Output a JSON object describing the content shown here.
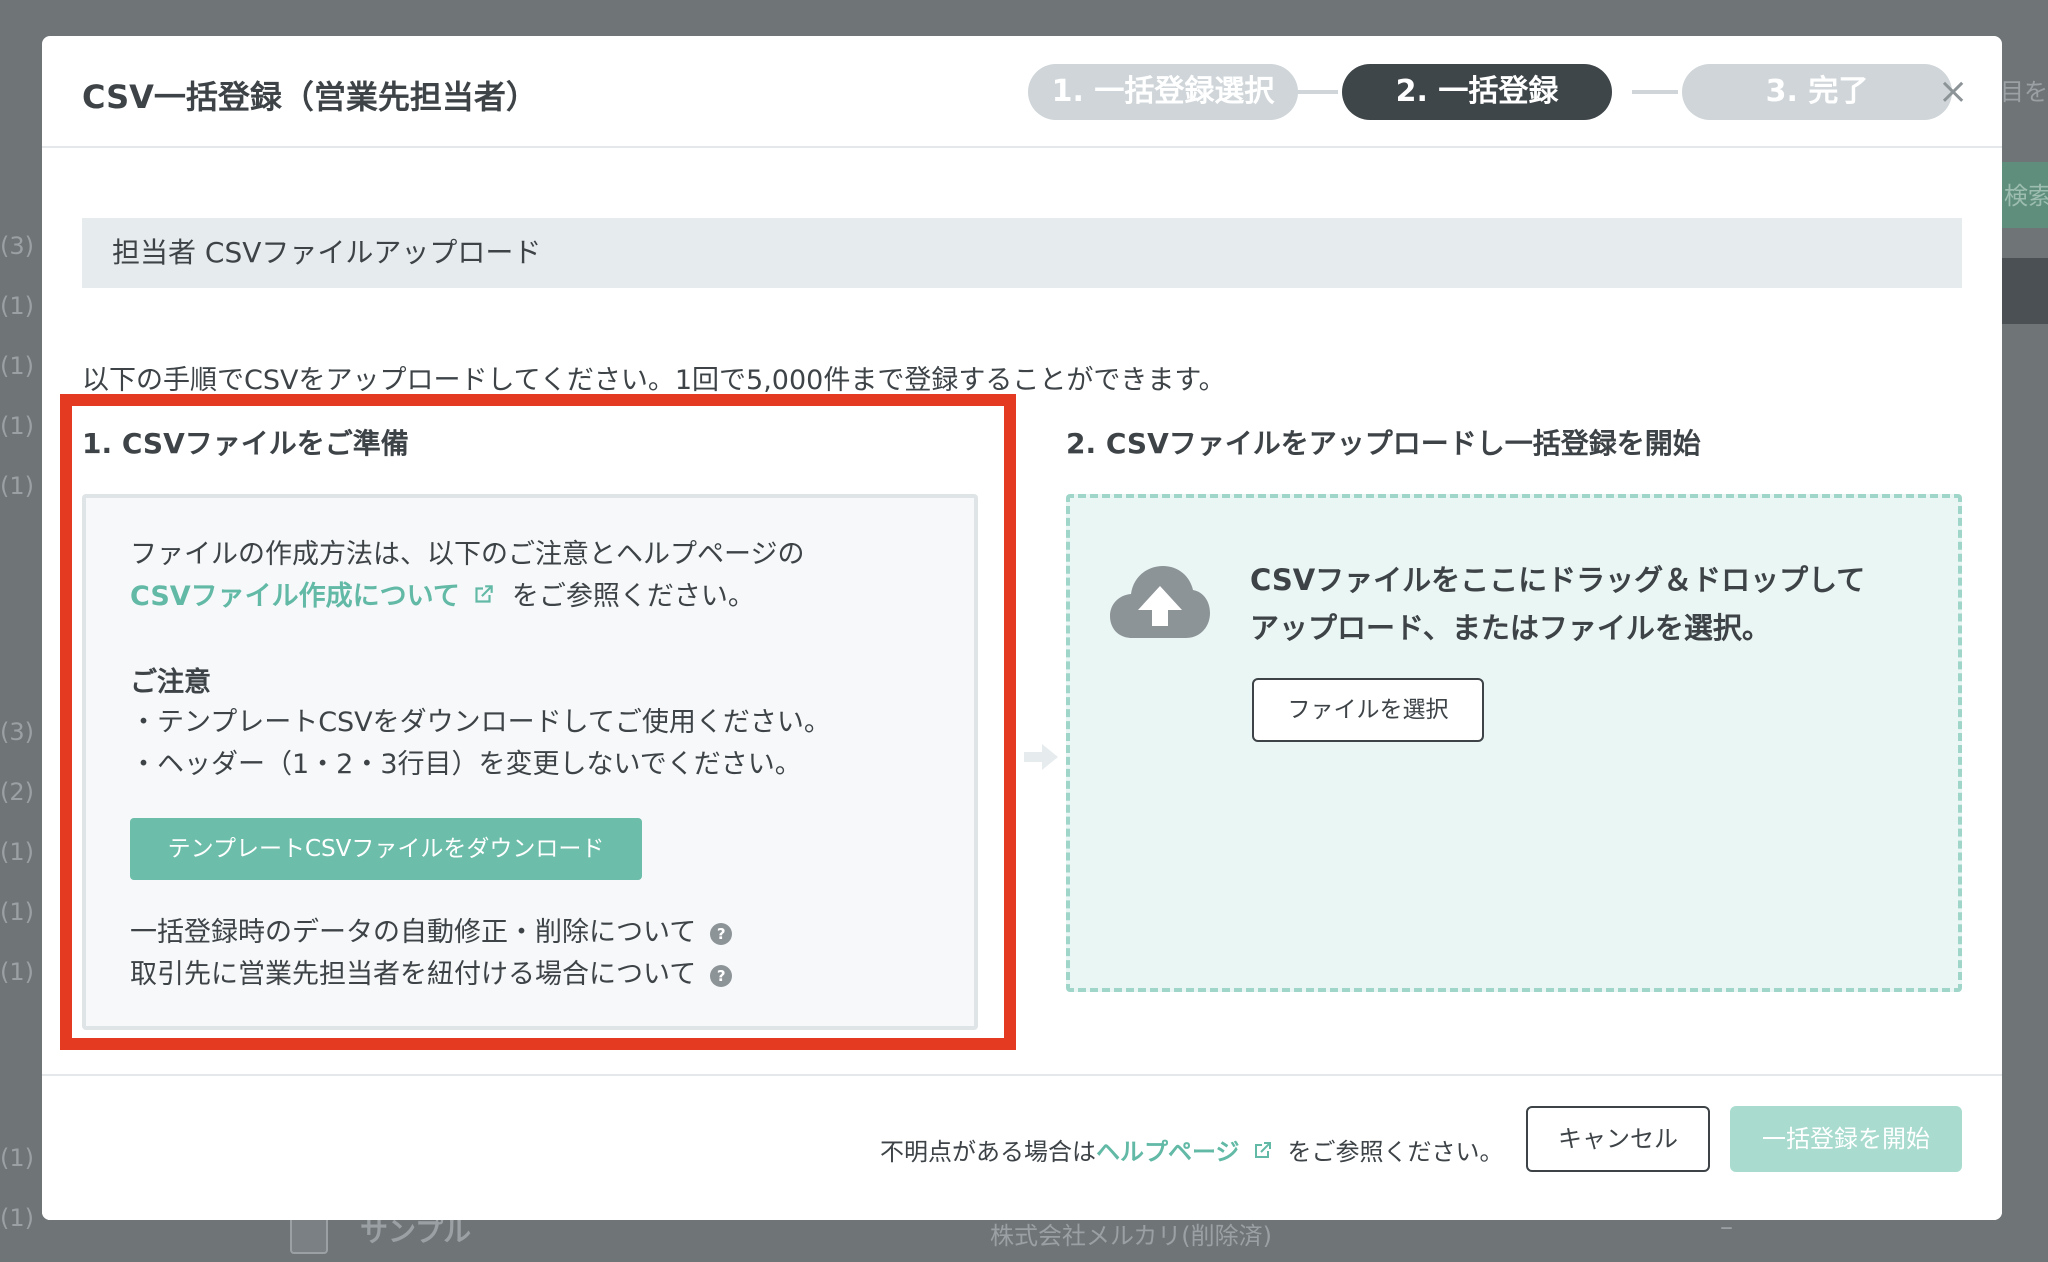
{
  "background": {
    "counts": [
      "(3)",
      "(1)",
      "(1)",
      "(1)",
      "(1)",
      "(3)",
      "(2)",
      "(1)",
      "(1)",
      "(1)",
      "(1)",
      "(1)"
    ],
    "right_text": "目を表",
    "right_button": "検索",
    "bottom_row": {
      "name": "サンプル",
      "company": "株式会社メルカリ(削除済)",
      "dash": "–"
    }
  },
  "modal": {
    "title": "CSV一括登録（営業先担当者）",
    "steps": [
      {
        "label": "1. 一括登録選択",
        "state": "inactive"
      },
      {
        "label": "2. 一括登録",
        "state": "active"
      },
      {
        "label": "3. 完了",
        "state": "inactive"
      }
    ],
    "close_symbol": "×",
    "section_title": "担当者 CSVファイルアップロード",
    "intro": "以下の手順でCSVをアップロードしてください。1回で5,000件まで登録することができます。",
    "prepare": {
      "title": "1. CSVファイルをご準備",
      "line1": "ファイルの作成方法は、以下のご注意とヘルプページの",
      "link": "CSVファイル作成について",
      "line2_suffix": "をご参照ください。",
      "notice_title": "ご注意",
      "notice_items": [
        "・テンプレートCSVをダウンロードしてご使用ください。",
        "・ヘッダー（1・2・3行目）を変更しないでください。"
      ],
      "download_button": "テンプレートCSVファイルをダウンロード",
      "help_links": [
        "一括登録時のデータの自動修正・削除について",
        "取引先に営業先担当者を紐付ける場合について"
      ],
      "help_symbol": "?"
    },
    "upload": {
      "title": "2. CSVファイルをアップロードし一括登録を開始",
      "drop_line1": "CSVファイルをここにドラッグ＆ドロップして",
      "drop_line2": "アップロード、またはファイルを選択。",
      "select_button": "ファイルを選択"
    },
    "footer": {
      "note_prefix": "不明点がある場合は",
      "note_link": "ヘルプページ",
      "note_suffix": "をご参照ください。",
      "cancel": "キャンセル",
      "start": "一括登録を開始"
    }
  },
  "colors": {
    "accent": "#62b9a6",
    "highlight": "#e53a22",
    "step_active": "#3f4649",
    "step_inactive": "#cfd5d8"
  }
}
